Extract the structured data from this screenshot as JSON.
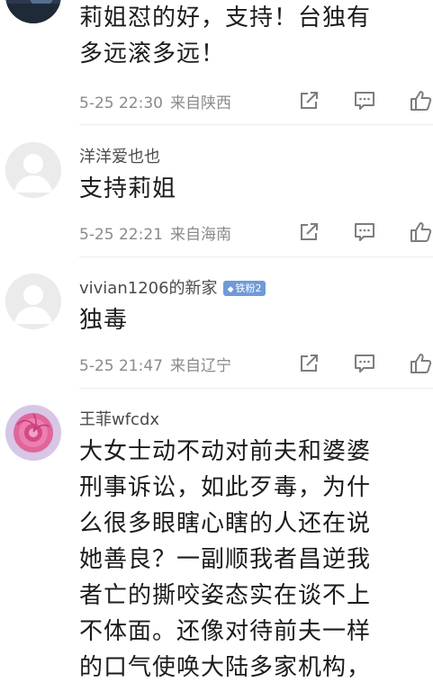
{
  "comments": [
    {
      "username": "",
      "text_lines": [
        "莉姐怼的好，支持！台独有",
        "多远滚多远！"
      ],
      "date": "5-25 22:30",
      "location": "来自陕西",
      "avatar": "dark-photo-avatar"
    },
    {
      "username": "洋洋爱也也",
      "text_lines": [
        "支持莉姐"
      ],
      "date": "5-25 22:21",
      "location": "来自海南",
      "avatar": "default-user-avatar"
    },
    {
      "username": "vivian1206的新家",
      "badge": "铁粉2",
      "text_lines": [
        "独毒"
      ],
      "date": "5-25 21:47",
      "location": "来自辽宁",
      "avatar": "default-user-avatar"
    },
    {
      "username": "王菲wfcdx",
      "text_lines": [
        "大女士动不动对前夫和婆婆",
        "刑事诉讼，如此歹毒，为什",
        "么很多眼瞎心瞎的人还在说",
        "她善良？一副顺我者昌逆我",
        "者亡的撕咬姿态实在谈不上",
        "不体面。还像对待前夫一样",
        "的口气使唤大陆多家机构，"
      ],
      "avatar": "pink-flower-avatar"
    }
  ],
  "icons": {
    "share": "share-icon",
    "reply": "comment-icon",
    "like": "thumbs-up-icon"
  },
  "colors": {
    "meta_text": "#8a8a8a",
    "badge": "#6f9ad8",
    "icon_stroke": "#7d7d7d"
  }
}
